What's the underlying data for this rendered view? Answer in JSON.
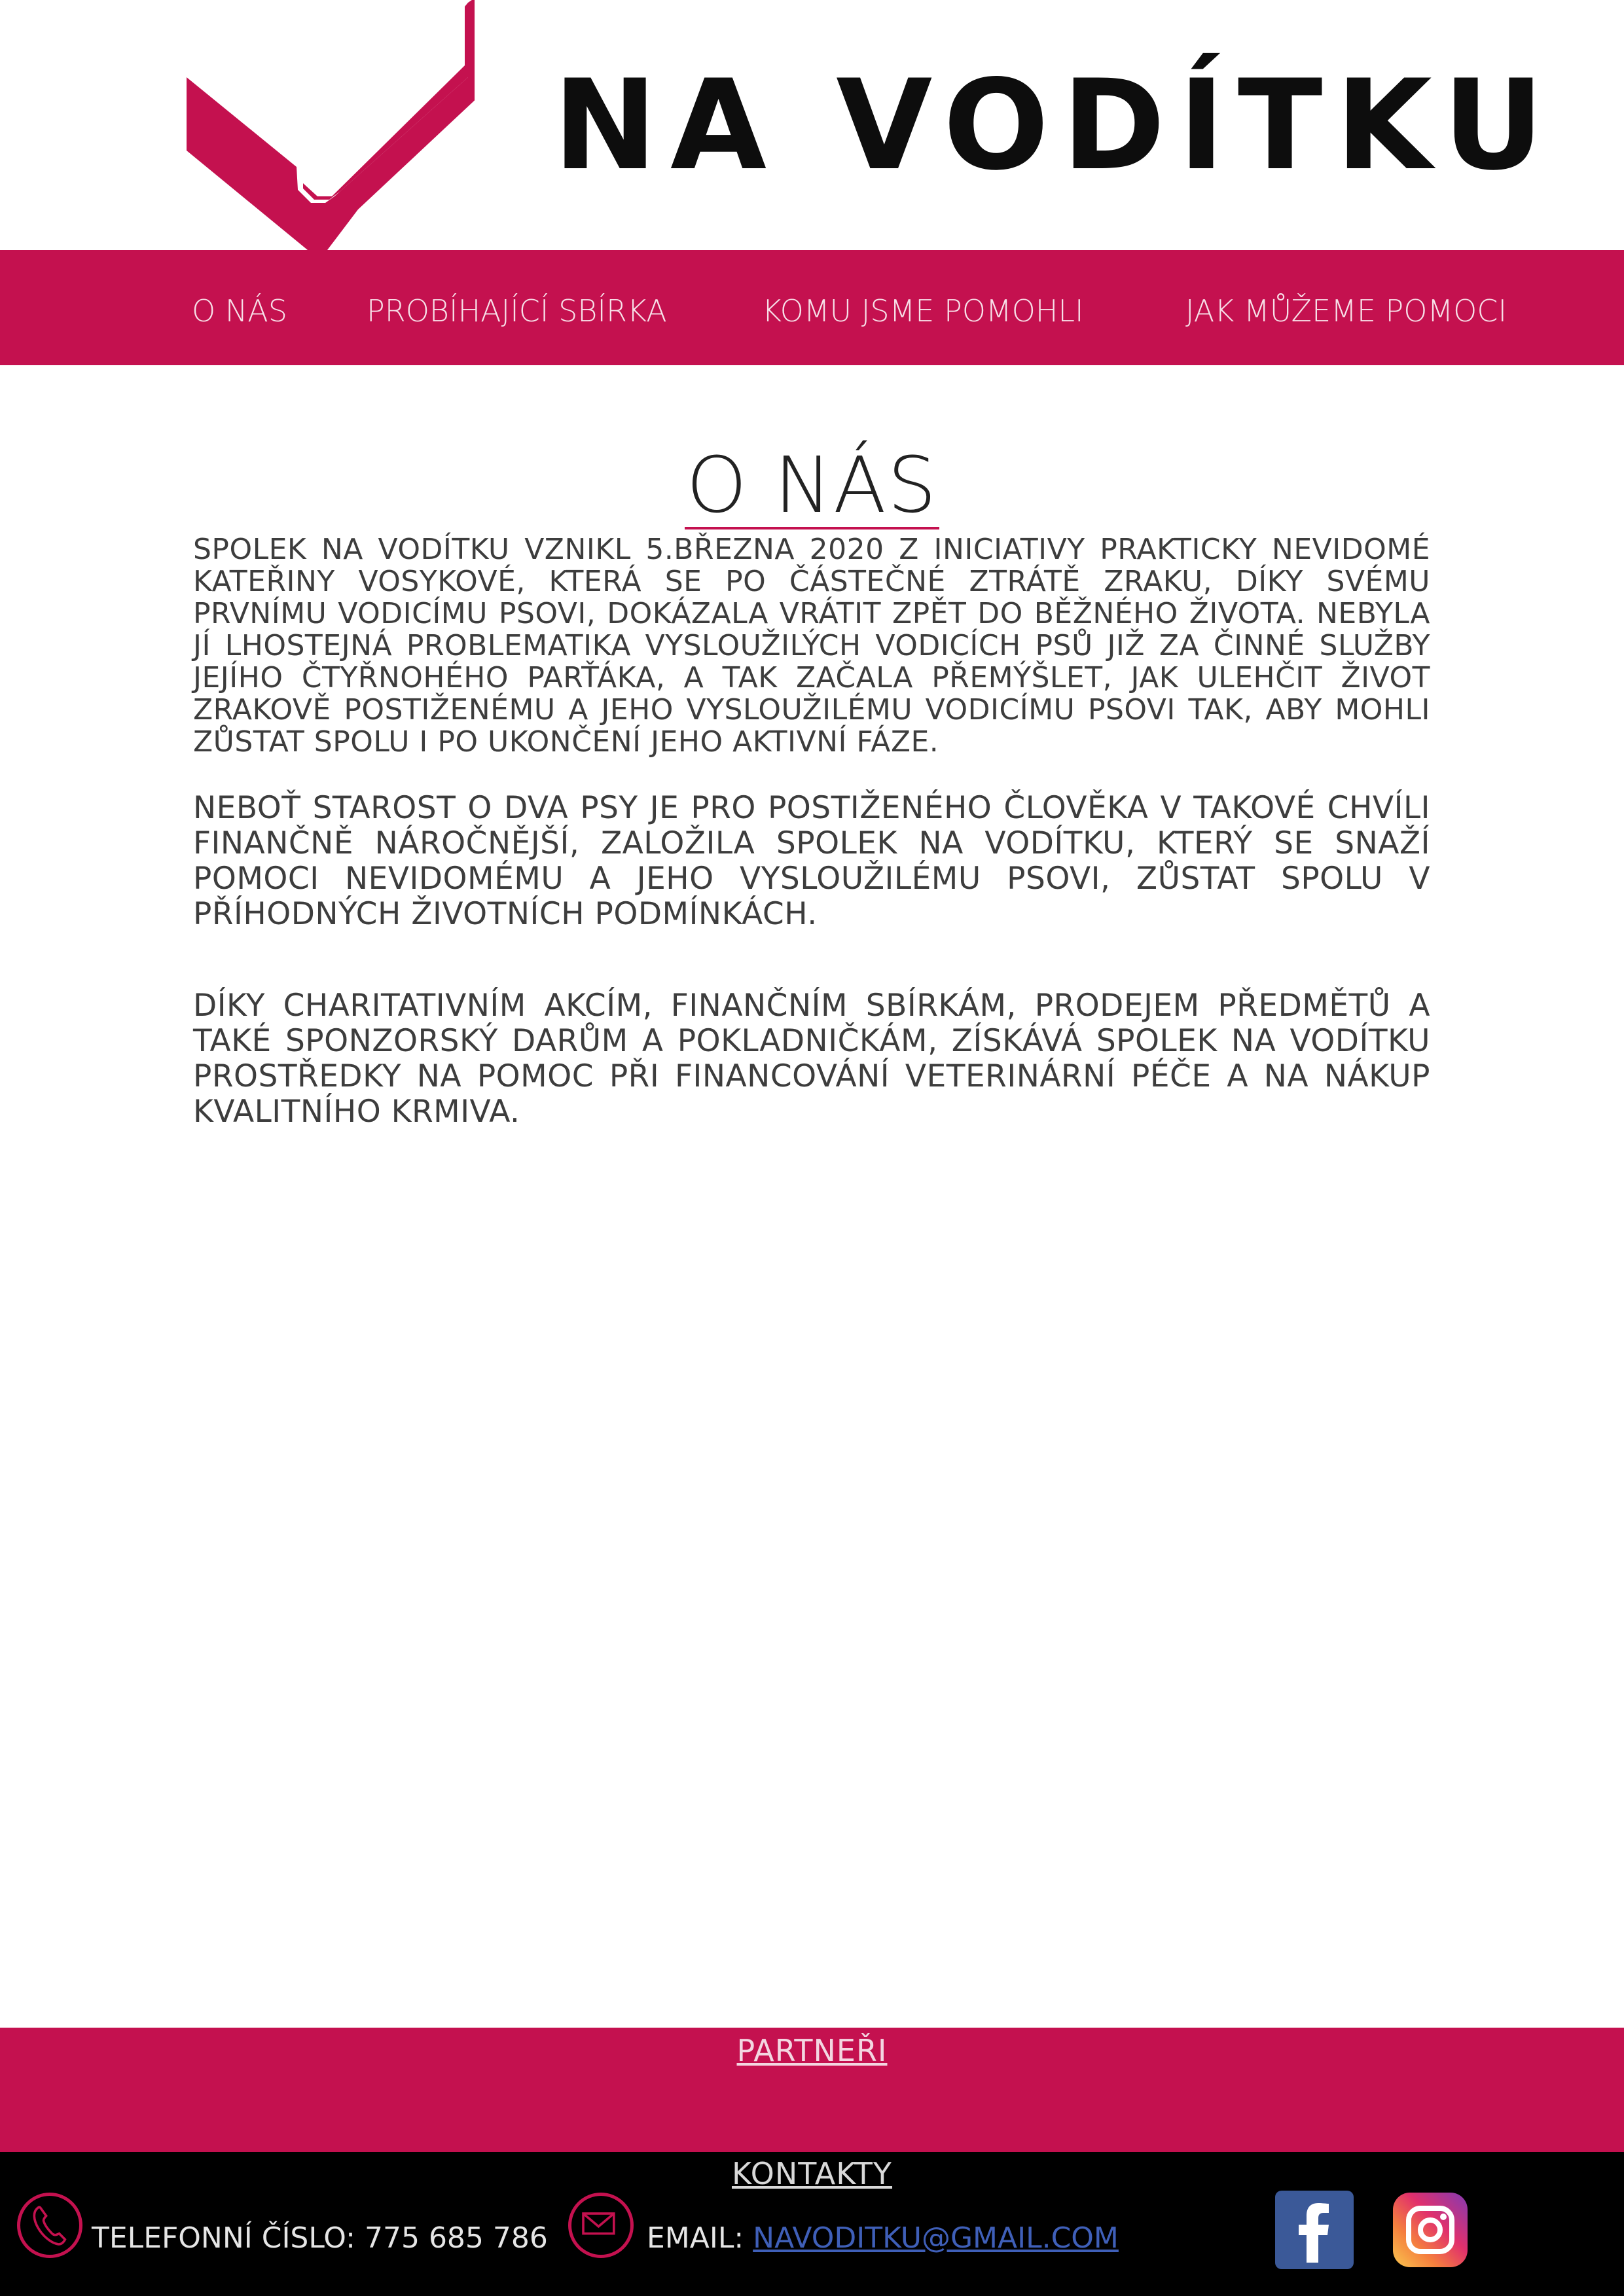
{
  "brand": {
    "name": "NA VODÍTKU",
    "logo_icon": "checkmark-logo",
    "accent": "#c4114f"
  },
  "nav": {
    "items": [
      {
        "label": "O NÁS"
      },
      {
        "label": "PROBÍHAJÍCÍ SBÍRKA"
      },
      {
        "label": "KOMU JSME POMOHLI"
      },
      {
        "label": "JAK MŮŽEME POMOCI"
      }
    ]
  },
  "main": {
    "title": "O NÁS",
    "paragraphs": [
      "Spolek Na vodítku vznikl 5.března 2020 z iniciativy prakticky nevidomé Kateřiny Vosykové, která se po částečné ztrátě zraku, díky svému prvnímu vodicímu psovi, dokázala vrátit zpět do běžného života. Nebyla jí lhostejná problematika vysloužilých vodicích psů již za činné služby jejího čtyřnohého parťáka, a tak začala přemýšlet, jak ulehčit život zrakově postiženému a jeho vysloužilému vodicímu psovi tak, aby mohli zůstat spolu i po ukončení jeho aktivní fáze.",
      "Neboť starost o dva psy je pro postiženého člověka v takové chvíli finančně náročnější, založila spolek Na vodítku, který se snaží pomoci nevidomému a jeho vysloužilému psovi, zůstat spolu v příhodných životních podmínkách.",
      "Díky charitativním akcím, finančním sbírkám, prodejem předmětů a také sponzorský darům a pokladničkám, získává spolek Na vodítku prostředky na pomoc při financování veterinární péče a na nákup kvalitního krmiva."
    ]
  },
  "footer": {
    "partners_label": "PARTNEŘI",
    "contacts_label": "KONTAKTY",
    "phone_label": "TELEFONNÍ ČÍSLO: 775 685 786",
    "email_label": "EMAIL: ",
    "email_value": "NAVODITKU@GMAIL.COM",
    "icons": [
      "phone-icon",
      "mail-icon",
      "facebook-icon",
      "instagram-icon"
    ]
  }
}
